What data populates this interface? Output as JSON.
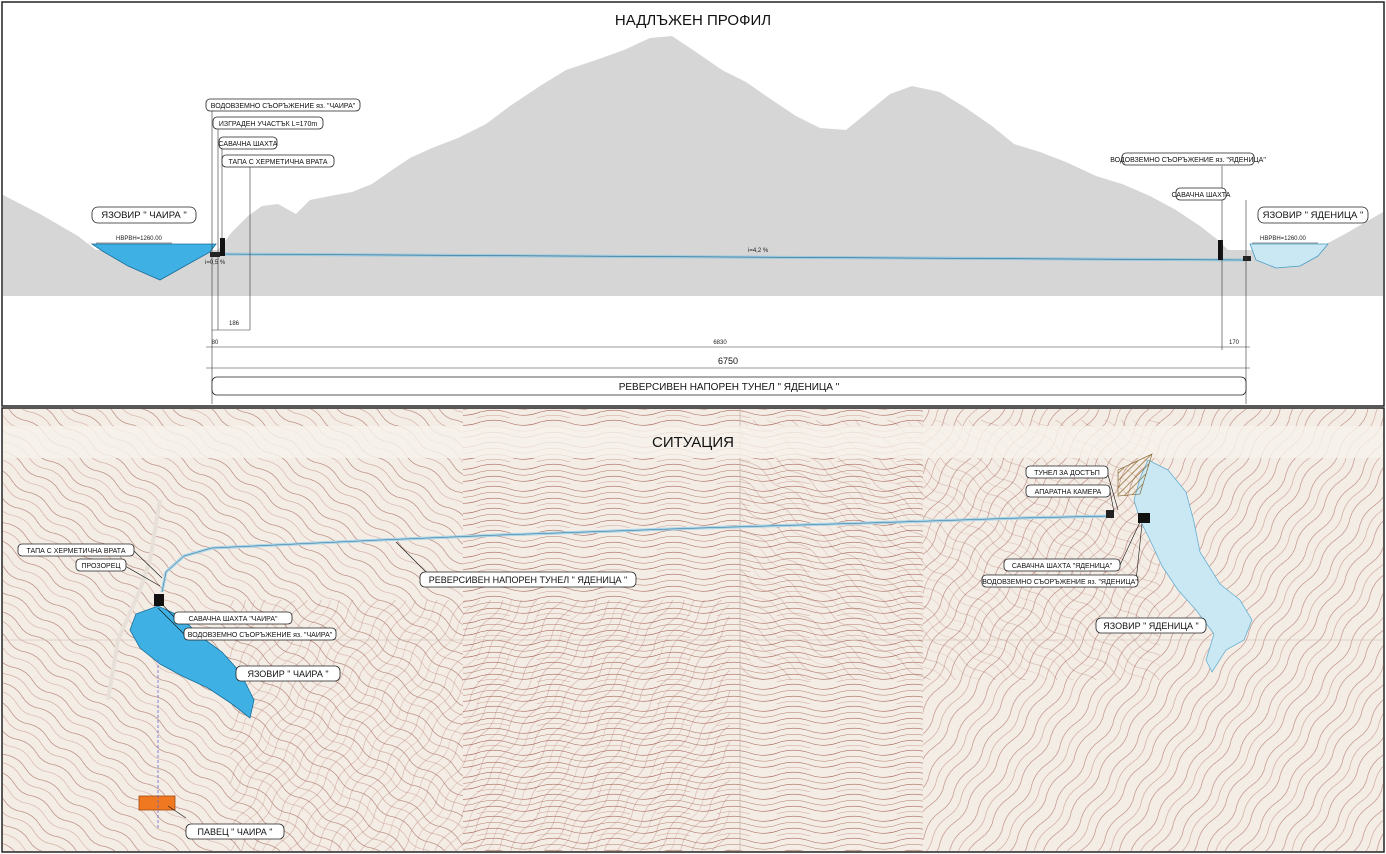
{
  "profile": {
    "title": "НАДЛЪЖЕН ПРОФИЛ",
    "labels": {
      "intake_chaira": "ВОДОВЗЕМНО СЪОРЪЖЕНИЕ яз. \"ЧАИРА\"",
      "built_section": "ИЗГРАДЕН УЧАСТЪК L=170m",
      "surge_shaft_left": "САВАЧНА ШАХТА",
      "plug_gate": "ТАПА С ХЕРМЕТИЧНА ВРАТА",
      "intake_yadenitsa": "ВОДОВЗЕМНО СЪОРЪЖЕНИЕ яз. \"ЯДЕНИЦА\"",
      "surge_shaft_right": "САВАЧНА ШАХТА",
      "reservoir_chaira": "ЯЗОВИР \" ЧАИРА \"",
      "reservoir_yadenitsa": "ЯЗОВИР \" ЯДЕНИЦА \"",
      "nvrvn_left": "НВРВН=1260.00",
      "nvrvn_right": "НВРВН=1260.00",
      "slope_main": "i=4,2 %",
      "slope_left": "i=0,5 %"
    },
    "dimensions": {
      "d_left": "80",
      "d_shaft": "186",
      "d_middle": "6830",
      "d_right": "170",
      "total": "6750"
    },
    "tunnel_label": "РЕВЕРСИВЕН НАПОРЕН ТУНЕЛ \" ЯДЕНИЦА \""
  },
  "situation": {
    "title": "СИТУАЦИЯ",
    "labels": {
      "plug_gate": "ТАПА С ХЕРМЕТИЧНА ВРАТА",
      "window": "ПРОЗОРЕЦ",
      "tunnel": "РЕВЕРСИВЕН НАПОРЕН ТУНЕЛ \" ЯДЕНИЦА \"",
      "surge_chaira": "САВАЧНА ШАХТА \"ЧАИРА\"",
      "intake_chaira": "ВОДОВЗЕМНО СЪОРЪЖЕНИЕ яз. \"ЧАИРА\"",
      "reservoir_chaira": "ЯЗОВИР \" ЧАИРА \"",
      "pavets": "ПАВЕЦ \" ЧАИРА \"",
      "access_tunnel": "ТУНЕЛ ЗА ДОСТЪП",
      "apparatus_chamber": "АПАРАТНА КАМЕРА",
      "surge_yadenitsa": "САВАЧНА ШАХТА \"ЯДЕНИЦА\"",
      "intake_yadenitsa": "ВОДОВЗЕМНО СЪОРЪЖЕНИЕ яз. \"ЯДЕНИЦА\"",
      "reservoir_yadenitsa": "ЯЗОВИР \" ЯДЕНИЦА \""
    }
  },
  "colors": {
    "water": "#3fb0e4",
    "water_light": "#c9e8f4",
    "terrain": "#d6d6d6",
    "contour": "#9a5a4a",
    "tunnel": "#a9d3e6",
    "pavets": "#f07820"
  }
}
